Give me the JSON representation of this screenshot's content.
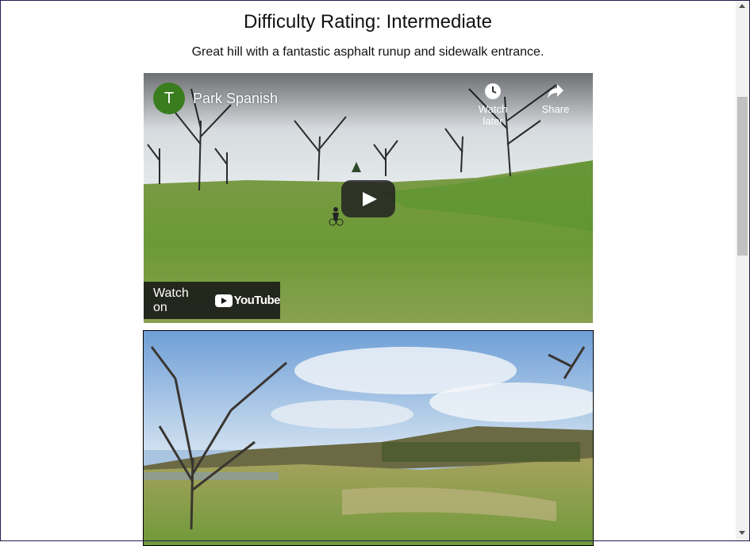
{
  "heading": "Difficulty Rating: Intermediate",
  "description": "Great hill with a fantastic asphalt runup and sidewalk entrance.",
  "video": {
    "channel_initial": "T",
    "channel_name": "Park Spanish",
    "watch_later_label": "Watch later",
    "share_label": "Share",
    "watch_on_label": "Watch on",
    "youtube_word": "YouTube",
    "avatar_color": "#3a7d1e"
  },
  "photo": {
    "subject": "park-hill-photo"
  }
}
